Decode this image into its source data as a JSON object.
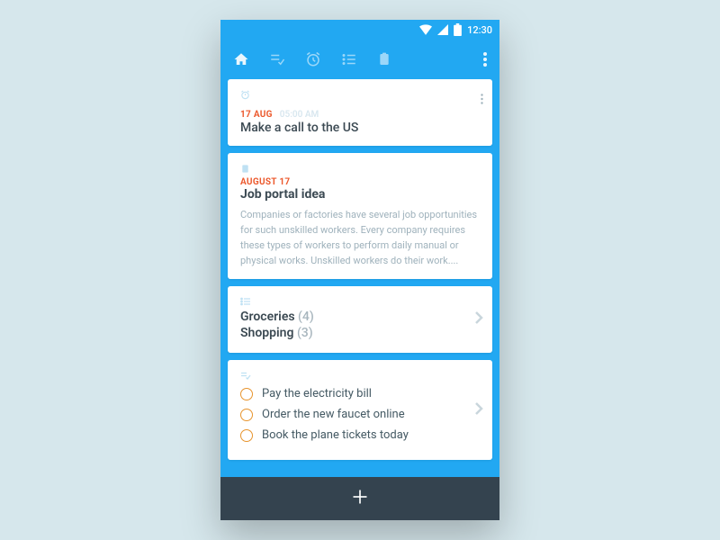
{
  "statusbar": {
    "time": "12:30"
  },
  "cards": {
    "reminder": {
      "date": "17 AUG",
      "time": "05:00 AM",
      "title": "Make a call to the US"
    },
    "note": {
      "date": "AUGUST 17",
      "title": "Job portal idea",
      "body": "Companies or factories have several job opportunities for such unskilled workers. Every company requires these types of workers to perform daily manual or physical works. Unskilled workers do their work...."
    },
    "lists": {
      "items": [
        {
          "label": "Groceries",
          "count": "(4)"
        },
        {
          "label": "Shopping",
          "count": "(3)"
        }
      ]
    },
    "todos": {
      "items": [
        {
          "label": "Pay the electricity bill"
        },
        {
          "label": "Order the new faucet online"
        },
        {
          "label": "Book the plane tickets today"
        }
      ]
    }
  }
}
